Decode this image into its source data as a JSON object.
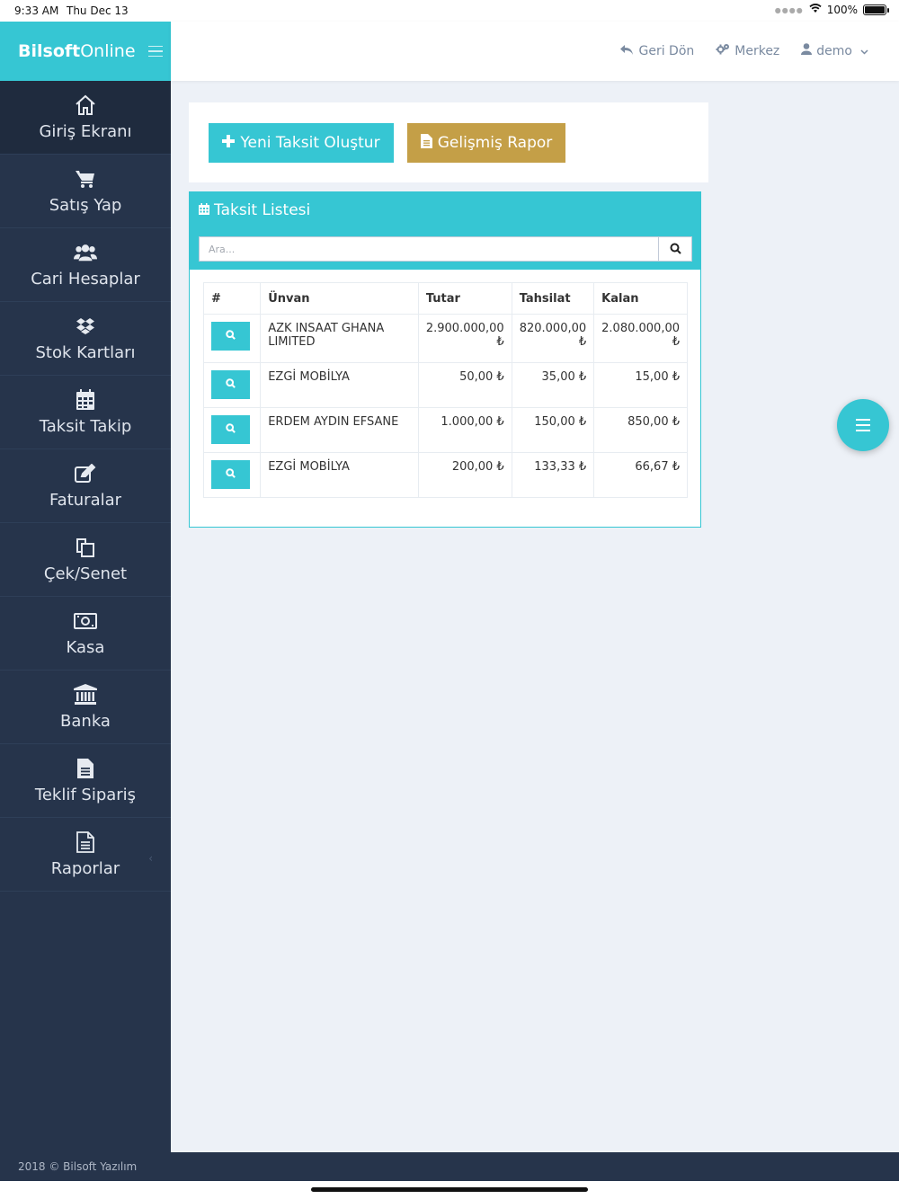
{
  "status_bar": {
    "time": "9:33 AM",
    "date": "Thu Dec 13",
    "battery": "100%"
  },
  "brand": {
    "bold": "Bilsoft",
    "light": "Online"
  },
  "sidebar": {
    "items": [
      {
        "label": "Giriş Ekranı",
        "icon": "home-icon"
      },
      {
        "label": "Satış Yap",
        "icon": "cart-icon"
      },
      {
        "label": "Cari Hesaplar",
        "icon": "users-icon"
      },
      {
        "label": "Stok Kartları",
        "icon": "dropbox-icon"
      },
      {
        "label": "Taksit Takip",
        "icon": "calendar-icon"
      },
      {
        "label": "Faturalar",
        "icon": "edit-icon"
      },
      {
        "label": "Çek/Senet",
        "icon": "copy-icon"
      },
      {
        "label": "Kasa",
        "icon": "money-icon"
      },
      {
        "label": "Banka",
        "icon": "bank-icon"
      },
      {
        "label": "Teklif Sipariş",
        "icon": "file-text-icon"
      },
      {
        "label": "Raporlar",
        "icon": "file-icon"
      }
    ]
  },
  "header": {
    "back": "Geri Dön",
    "branch": "Merkez",
    "user": "demo"
  },
  "actions": {
    "new_installment": "Yeni Taksit Oluştur",
    "advanced_report": "Gelişmiş Rapor"
  },
  "panel": {
    "title": "Taksit Listesi",
    "search_placeholder": "Ara...",
    "columns": [
      "#",
      "Ünvan",
      "Tutar",
      "Tahsilat",
      "Kalan"
    ],
    "rows": [
      {
        "title": "AZK INSAAT GHANA LIMITED",
        "amount": "2.900.000,00 ₺",
        "collected": "820.000,00 ₺",
        "remaining": "2.080.000,00 ₺"
      },
      {
        "title": "EZGİ MOBİLYA",
        "amount": "50,00 ₺",
        "collected": "35,00 ₺",
        "remaining": "15,00 ₺"
      },
      {
        "title": "ERDEM AYDIN EFSANE",
        "amount": "1.000,00 ₺",
        "collected": "150,00 ₺",
        "remaining": "850,00 ₺"
      },
      {
        "title": "EZGİ MOBİLYA",
        "amount": "200,00 ₺",
        "collected": "133,33 ₺",
        "remaining": "66,67 ₺"
      }
    ]
  },
  "footer": {
    "text": "2018 © Bilsoft Yazılım"
  },
  "colors": {
    "accent": "#36c6d3",
    "gold": "#c49f47",
    "sidebar": "#26344b"
  }
}
